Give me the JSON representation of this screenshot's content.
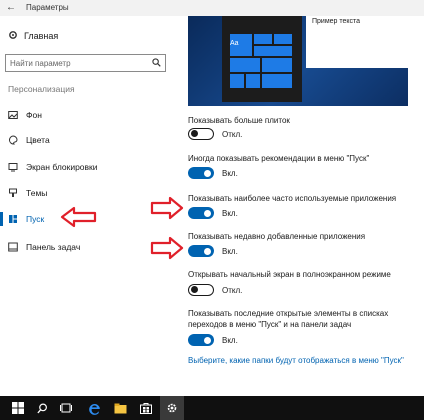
{
  "window": {
    "title": "Параметры"
  },
  "sidebar": {
    "home_label": "Главная",
    "search_placeholder": "Найти параметр",
    "section_label": "Персонализация",
    "items": [
      {
        "label": "Фон",
        "icon": "image-icon"
      },
      {
        "label": "Цвета",
        "icon": "palette-icon"
      },
      {
        "label": "Экран блокировки",
        "icon": "lock-screen-icon"
      },
      {
        "label": "Темы",
        "icon": "brush-icon"
      },
      {
        "label": "Пуск",
        "icon": "start-icon",
        "active": true
      },
      {
        "label": "Панель задач",
        "icon": "taskbar-icon"
      }
    ]
  },
  "preview": {
    "sample_text": "Пример текста",
    "tile_label": "Aa"
  },
  "settings": [
    {
      "label": "Показывать больше плиток",
      "state": "Откл.",
      "on": false
    },
    {
      "label": "Иногда показывать рекомендации в меню \"Пуск\"",
      "state": "Вкл.",
      "on": true
    },
    {
      "label": "Показывать наиболее часто используемые приложения",
      "state": "Вкл.",
      "on": true
    },
    {
      "label": "Показывать недавно добавленные приложения",
      "state": "Вкл.",
      "on": true
    },
    {
      "label": "Открывать начальный экран в полноэкранном режиме",
      "state": "Откл.",
      "on": false
    }
  ],
  "last_setting": {
    "label_line1": "Показывать последние открытые элементы в списках",
    "label_line2": "переходов в меню \"Пуск\" и на панели задач",
    "state": "Вкл.",
    "on": true
  },
  "link_text": "Выберите, какие папки будут отображаться в меню \"Пуск\"",
  "colors": {
    "accent": "#0063b1",
    "arrow": "#e0202a",
    "taskbar": "#101010"
  },
  "taskbar": {
    "items": [
      "start-icon",
      "search-icon",
      "task-view-icon",
      "edge-icon",
      "explorer-icon",
      "store-icon",
      "settings-icon"
    ]
  }
}
